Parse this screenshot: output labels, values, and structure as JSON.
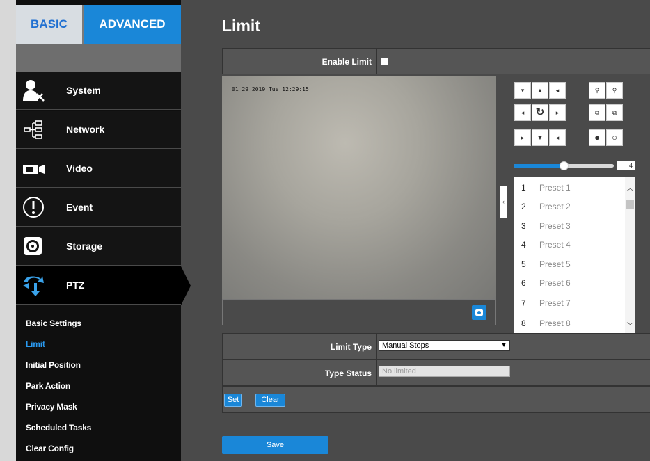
{
  "nav": {
    "basic_tab": "BASIC",
    "advanced_tab": "ADVANCED"
  },
  "menu": [
    {
      "label": "System",
      "icon": "system-user-icon"
    },
    {
      "label": "Network",
      "icon": "network-icon"
    },
    {
      "label": "Video",
      "icon": "video-camera-icon"
    },
    {
      "label": "Event",
      "icon": "event-alert-icon"
    },
    {
      "label": "Storage",
      "icon": "storage-disk-icon"
    },
    {
      "label": "PTZ",
      "icon": "ptz-arrows-icon"
    }
  ],
  "submenu": [
    "Basic Settings",
    "Limit",
    "Initial Position",
    "Park Action",
    "Privacy Mask",
    "Scheduled Tasks",
    "Clear Config"
  ],
  "page": {
    "title": "Limit",
    "enable_label": "Enable Limit",
    "osd_text": "01 29 2019 Tue 12:29:15",
    "limit_type_label": "Limit Type",
    "limit_type_value": "Manual Stops",
    "type_status_label": "Type Status",
    "type_status_value": "No limited",
    "set_label": "Set",
    "clear_label": "Clear",
    "save_label": "Save"
  },
  "ptz": {
    "speed_value": "4",
    "speed_fraction": 0.5,
    "presets": [
      {
        "num": "1",
        "name": "Preset 1"
      },
      {
        "num": "2",
        "name": "Preset 2"
      },
      {
        "num": "3",
        "name": "Preset 3"
      },
      {
        "num": "4",
        "name": "Preset 4"
      },
      {
        "num": "5",
        "name": "Preset 5"
      },
      {
        "num": "6",
        "name": "Preset 6"
      },
      {
        "num": "7",
        "name": "Preset 7"
      },
      {
        "num": "8",
        "name": "Preset 8"
      }
    ]
  },
  "colors": {
    "accent": "#1a87d8",
    "active_link": "#2a9af0",
    "sidebar_bg": "#0f0f0f"
  }
}
